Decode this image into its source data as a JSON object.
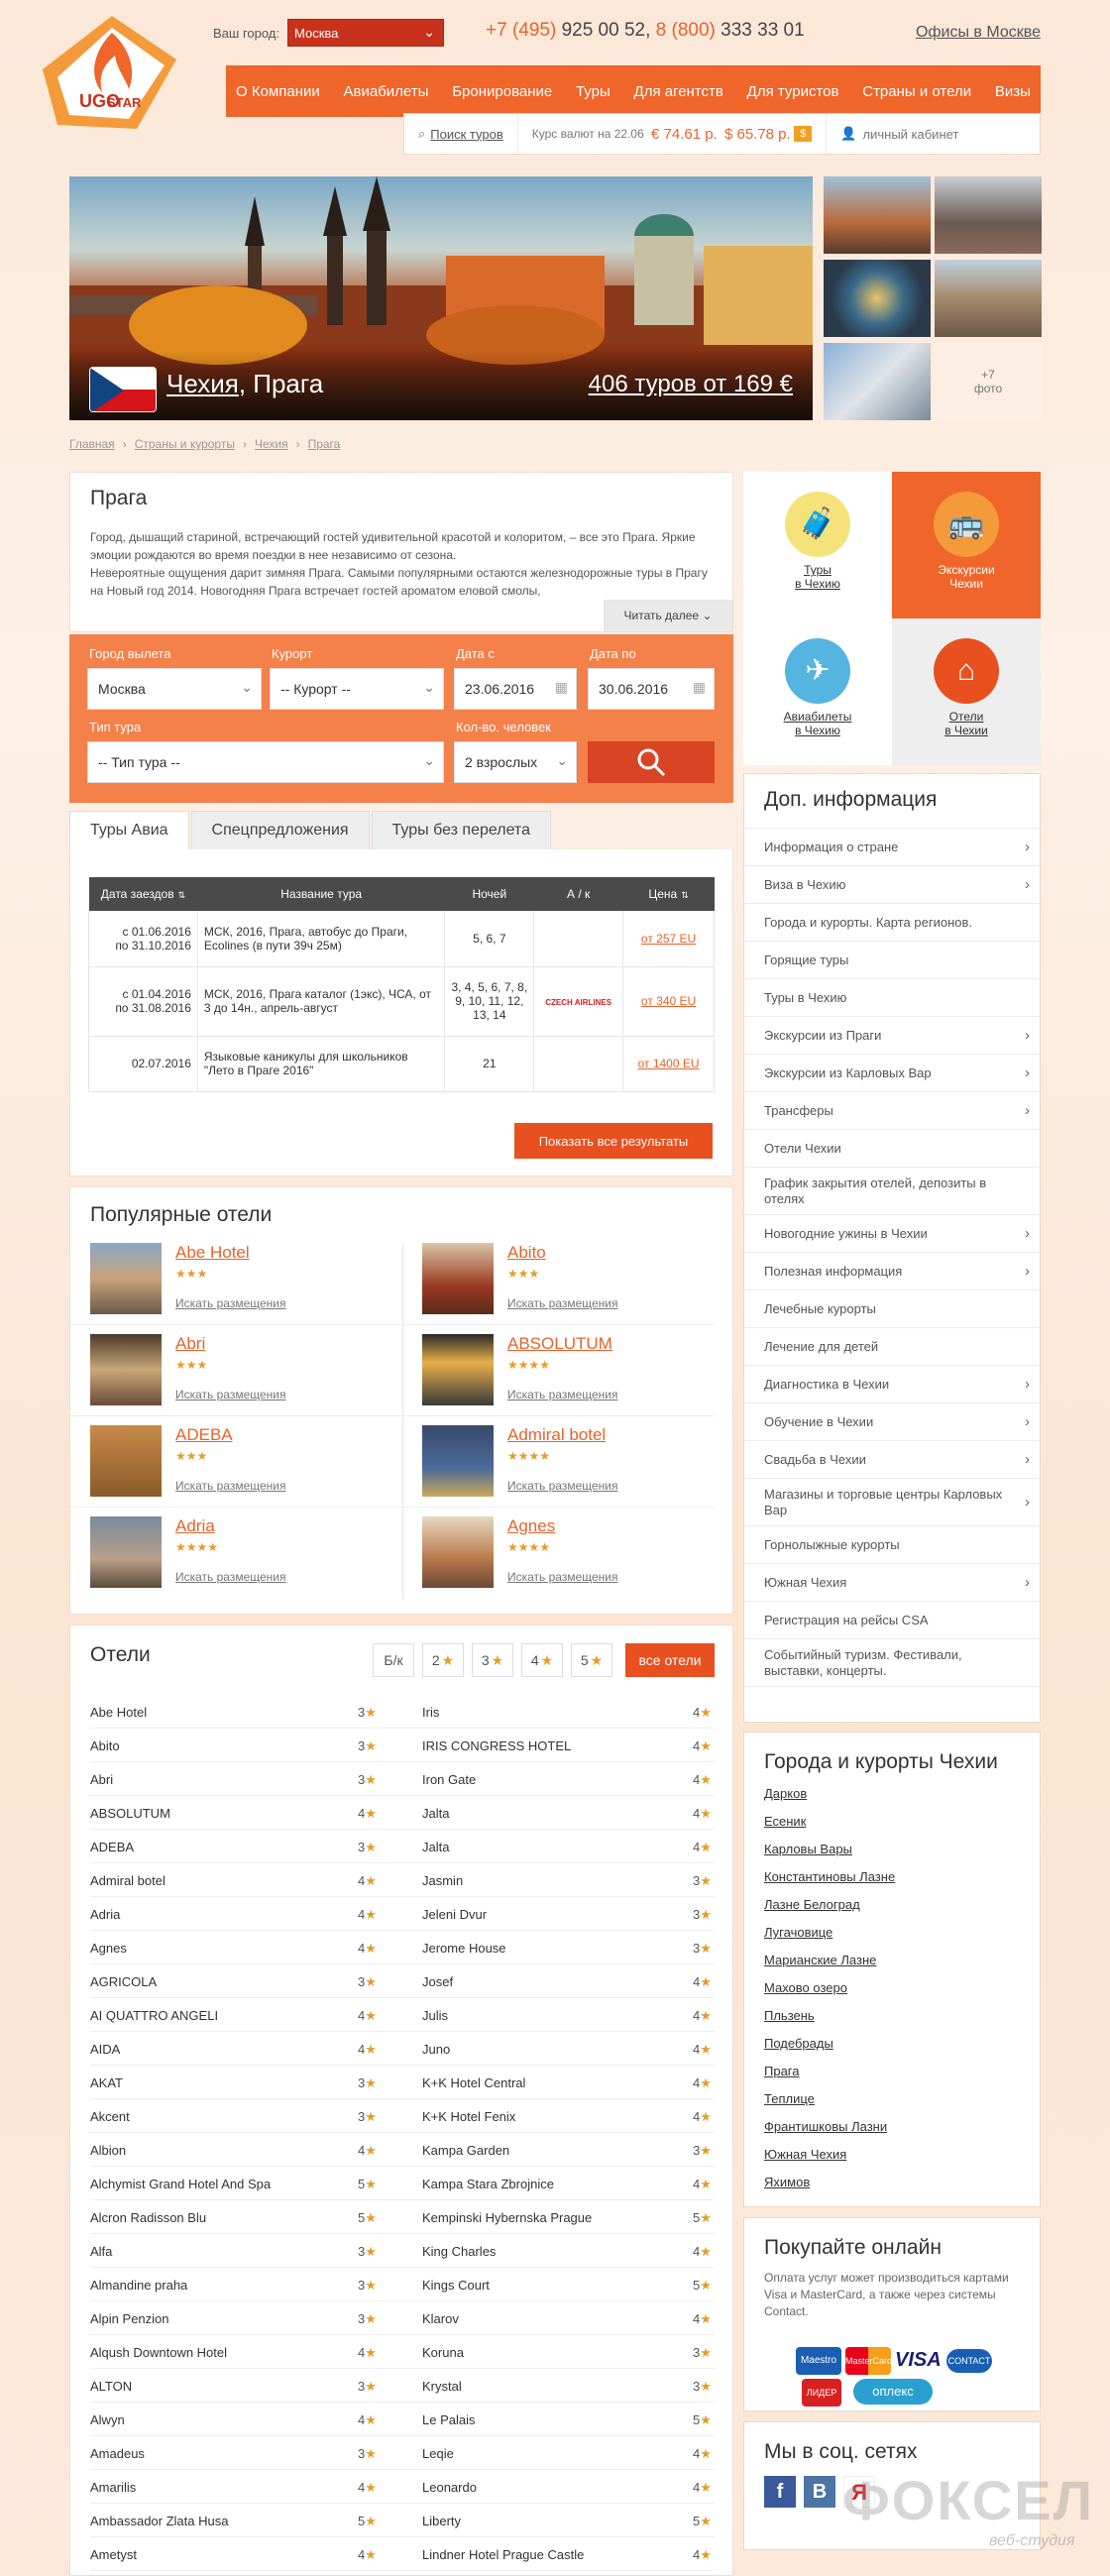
{
  "brand": {
    "logo_text_top": "UGO",
    "logo_text_bottom": "STAR"
  },
  "header": {
    "city_label": "Ваш город:",
    "city_value": "Москва",
    "phone1_prefix": "+7 (495)",
    "phone1_num": "925 00 52,",
    "phone2_prefix": "8 (800)",
    "phone2_num": "333 33 01",
    "offices_link": "Офисы в Москве"
  },
  "nav": [
    "О Компании",
    "Авиабилеты",
    "Бронирование",
    "Туры",
    "Для агентств",
    "Для туристов",
    "Страны и отели",
    "Визы"
  ],
  "subbar": {
    "search_tours": "Поиск туров",
    "rates_label": "Курс валют на 22.06",
    "eur": "€ 74.61 р.",
    "usd": "$ 65.78 р.",
    "cabinet": "личный кабинет"
  },
  "hero": {
    "country": "Чехия",
    "city": ", Прага",
    "offer": "406 туров от 169 €",
    "more_photos": "+7\nфото"
  },
  "breadcrumbs": [
    "Главная",
    "Страны и курорты",
    "Чехия",
    "Прага"
  ],
  "intro": {
    "title": "Прага",
    "p1": "Город, дышащий стариной, встречающий гостей удивительной красотой и колоритом, – все это Прага. Яркие эмоции рождаются во время поездки в нее независимо от сезона.",
    "p2": "Невероятные ощущения дарит зимняя Прага. Самыми популярными остаются железнодорожные туры в Прагу на Новый год 2014. Новогодняя Прага встречает гостей ароматом еловой смолы,",
    "read_more": "Читать далее"
  },
  "search_form": {
    "from_label": "Город вылета",
    "from_value": "Москва",
    "resort_label": "Курорт",
    "resort_value": "-- Курорт --",
    "date_from_label": "Дата с",
    "date_from_value": "23.06.2016",
    "date_to_label": "Дата по",
    "date_to_value": "30.06.2016",
    "type_label": "Тип тура",
    "type_value": "-- Тип тура --",
    "people_label": "Кол-во. человек",
    "people_value": "2 взрослых"
  },
  "tabs": [
    "Туры Авиа",
    "Спецпредложения",
    "Туры без перелета"
  ],
  "tours_table": {
    "headers": [
      "Дата заездов",
      "Название тура",
      "Ночей",
      "А / к",
      "Цена"
    ],
    "rows": [
      {
        "date": "с 01.06.2016\nпо 31.10.2016",
        "name": "МСК, 2016, Прага, автобус до Праги, Ecolines (в пути 39ч 25м)",
        "nights": "5, 6, 7",
        "airline": "",
        "price": "от 257 EU"
      },
      {
        "date": "с 01.04.2016\nпо 31.08.2016",
        "name": "МСК, 2016, Прага каталог (1экс), ЧСА, от 3 до 14н., апрель-август",
        "nights": "3, 4, 5, 6, 7, 8, 9, 10, 11, 12, 13, 14",
        "airline": "CZECH AIRLINES",
        "price": "от 340 EU"
      },
      {
        "date": "02.07.2016",
        "name": "Языковые каникулы для школьников \"Лето в Праге 2016\"",
        "nights": "21",
        "airline": "",
        "price": "от 1400 EU"
      }
    ],
    "show_all": "Показать все результаты"
  },
  "popular": {
    "title": "Популярные отели",
    "search_link": "Искать размещения",
    "hotels": [
      {
        "name": "Abe Hotel",
        "stars": "★★★"
      },
      {
        "name": "Abito",
        "stars": "★★★"
      },
      {
        "name": "Abri",
        "stars": "★★★"
      },
      {
        "name": "ABSOLUTUM",
        "stars": "★★★★"
      },
      {
        "name": "ADEBA",
        "stars": "★★★"
      },
      {
        "name": "Admiral botel",
        "stars": "★★★★"
      },
      {
        "name": "Adria",
        "stars": "★★★★"
      },
      {
        "name": "Agnes",
        "stars": "★★★★"
      }
    ]
  },
  "hotels": {
    "title": "Отели",
    "filters": [
      "Б/к",
      "2",
      "3",
      "4",
      "5"
    ],
    "all_label": "все отели",
    "left": [
      [
        "Abe Hotel",
        "3"
      ],
      [
        "Abito",
        "3"
      ],
      [
        "Abri",
        "3"
      ],
      [
        "ABSOLUTUM",
        "4"
      ],
      [
        "ADEBA",
        "3"
      ],
      [
        "Admiral botel",
        "4"
      ],
      [
        "Adria",
        "4"
      ],
      [
        "Agnes",
        "4"
      ],
      [
        "AGRICOLA",
        "3"
      ],
      [
        "AI QUATTRO ANGELI",
        "4"
      ],
      [
        "AIDA",
        "4"
      ],
      [
        "AKAT",
        "3"
      ],
      [
        "Akcent",
        "3"
      ],
      [
        "Albion",
        "4"
      ],
      [
        "Alchymist Grand Hotel And Spa",
        "5"
      ],
      [
        "Alcron Radisson Blu",
        "5"
      ],
      [
        "Alfa",
        "3"
      ],
      [
        "Almandine praha",
        "3"
      ],
      [
        "Alpin Penzion",
        "3"
      ],
      [
        "Alqush Downtown Hotel",
        "4"
      ],
      [
        "ALTON",
        "3"
      ],
      [
        "Alwyn",
        "4"
      ],
      [
        "Amadeus",
        "3"
      ],
      [
        "Amarilis",
        "4"
      ],
      [
        "Ambassador Zlata Husa",
        "5"
      ],
      [
        "Ametyst",
        "4"
      ]
    ],
    "right": [
      [
        "Iris",
        "4"
      ],
      [
        "IRIS CONGRESS HOTEL",
        "4"
      ],
      [
        "Iron Gate",
        "4"
      ],
      [
        "Jalta",
        "4"
      ],
      [
        "Jalta",
        "4"
      ],
      [
        "Jasmin",
        "3"
      ],
      [
        "Jeleni Dvur",
        "3"
      ],
      [
        "Jerome House",
        "3"
      ],
      [
        "Josef",
        "4"
      ],
      [
        "Julis",
        "4"
      ],
      [
        "Juno",
        "4"
      ],
      [
        "K+K Hotel Central",
        "4"
      ],
      [
        "K+K Hotel Fenix",
        "4"
      ],
      [
        "Kampa Garden",
        "3"
      ],
      [
        "Kampa Stara Zbrojnice",
        "4"
      ],
      [
        "Kempinski Hybernska Prague",
        "5"
      ],
      [
        "King Charles",
        "4"
      ],
      [
        "Kings Court",
        "5"
      ],
      [
        "Klarov",
        "4"
      ],
      [
        "Koruna",
        "3"
      ],
      [
        "Krystal",
        "3"
      ],
      [
        "Le Palais",
        "5"
      ],
      [
        "Leqie",
        "4"
      ],
      [
        "Leonardo",
        "4"
      ],
      [
        "Liberty",
        "5"
      ],
      [
        "Lindner Hotel Prague Castle",
        "4"
      ]
    ]
  },
  "tiles": [
    {
      "label": "Туры\nв Чехию"
    },
    {
      "label": "Экскурсии\nЧехии"
    },
    {
      "label": "Авиабилеты\nв Чехию"
    },
    {
      "label": "Отели\nв Чехии"
    }
  ],
  "extra": {
    "title": "Доп. информация",
    "items": [
      {
        "t": "Информация о стране",
        "a": true
      },
      {
        "t": "Виза в Чехию",
        "a": true
      },
      {
        "t": "Города и курорты. Карта регионов.",
        "a": false
      },
      {
        "t": "Горящие туры",
        "a": false
      },
      {
        "t": "Туры в Чехию",
        "a": false
      },
      {
        "t": "Экскурсии из Праги",
        "a": true
      },
      {
        "t": "Экскурсии из Карловых Вар",
        "a": true
      },
      {
        "t": "Трансферы",
        "a": true
      },
      {
        "t": "Отели Чехии",
        "a": false
      },
      {
        "t": "График закрытия отелей, депозиты в отелях",
        "a": false
      },
      {
        "t": "Новогодние ужины в Чехии",
        "a": true
      },
      {
        "t": "Полезная информация",
        "a": true
      },
      {
        "t": "Лечебные курорты",
        "a": false
      },
      {
        "t": "Лечение для детей",
        "a": false
      },
      {
        "t": "Диагностика в Чехии",
        "a": true
      },
      {
        "t": "Обучение в Чехии",
        "a": true
      },
      {
        "t": "Свадьба в Чехии",
        "a": true
      },
      {
        "t": "Магазины и торговые центры Карловых Вар",
        "a": true
      },
      {
        "t": "Горнолыжные курорты",
        "a": false
      },
      {
        "t": "Южная Чехия",
        "a": true
      },
      {
        "t": "Регистрация на рейсы CSA",
        "a": false
      },
      {
        "t": "Событийный туризм. Фестивали, выставки, концерты.",
        "a": false
      }
    ]
  },
  "cities": {
    "title": "Города и курорты Чехии",
    "items": [
      "Дарков",
      "Есеник",
      "Карловы Вары",
      "Константиновы Лазне",
      "Лазне Белоград",
      "Лугачовице",
      "Марианские Лазне",
      "Махово озеро",
      "Пльзень",
      "Подебрады",
      "Прага",
      "Теплице",
      "Франтишковы Лазни",
      "Южная Чехия",
      "Яхимов"
    ]
  },
  "buy": {
    "title": "Покупайте онлайн",
    "text": "Оплата услуг может производиться картами Visa и MasterCard, а также через системы Contact.",
    "logos": [
      "Maestro",
      "MasterCard",
      "VISA",
      "CONTACT",
      "ЛИДЕР",
      "оплекс"
    ]
  },
  "social": {
    "title": "Мы в соц. сетях",
    "icons": [
      "f",
      "B",
      "Я"
    ]
  },
  "watermark": {
    "brand": "ФОКСЕЛ",
    "sub": "веб-студия"
  },
  "colors": {
    "accent": "#f0652a",
    "accent_dark": "#c8321d",
    "star": "#e89b2a"
  }
}
